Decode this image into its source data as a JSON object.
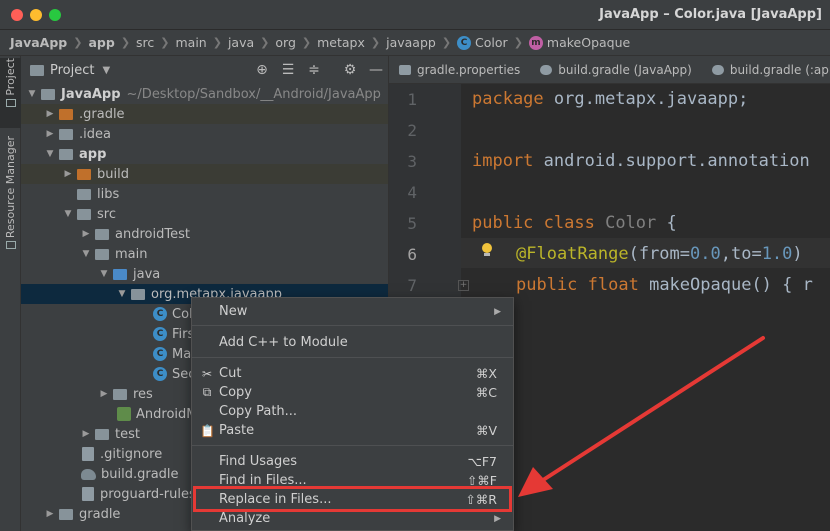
{
  "window": {
    "title": "JavaApp – Color.java [JavaApp]"
  },
  "breadcrumbs": [
    {
      "label": "JavaApp",
      "bold": true
    },
    {
      "label": "app",
      "bold": true
    },
    {
      "label": "src"
    },
    {
      "label": "main"
    },
    {
      "label": "java"
    },
    {
      "label": "org"
    },
    {
      "label": "metapx"
    },
    {
      "label": "javaapp"
    },
    {
      "label": "Color",
      "icon": "class-icon"
    },
    {
      "label": "makeOpaque",
      "icon": "method-icon"
    }
  ],
  "side_tabs": {
    "project": "Project",
    "resource_manager": "Resource Manager"
  },
  "project_panel": {
    "title": "Project"
  },
  "tree": [
    {
      "label": "JavaApp",
      "path": "~/Desktop/Sandbox/__Android/JavaApp"
    },
    {
      "label": ".gradle"
    },
    {
      "label": ".idea"
    },
    {
      "label": "app"
    },
    {
      "label": "build"
    },
    {
      "label": "libs"
    },
    {
      "label": "src"
    },
    {
      "label": "androidTest"
    },
    {
      "label": "main"
    },
    {
      "label": "java"
    },
    {
      "label": "org.metapx.javaapp"
    },
    {
      "label": "Col"
    },
    {
      "label": "Firs"
    },
    {
      "label": "Mai"
    },
    {
      "label": "Sec"
    },
    {
      "label": "res"
    },
    {
      "label": "AndroidM"
    },
    {
      "label": "test"
    },
    {
      "label": ".gitignore"
    },
    {
      "label": "build.gradle"
    },
    {
      "label": "proguard-rules"
    },
    {
      "label": "gradle"
    }
  ],
  "editor_tabs": [
    {
      "label": "gradle.properties"
    },
    {
      "label": "build.gradle (JavaApp)"
    },
    {
      "label": "build.gradle (:app)"
    }
  ],
  "code": {
    "line_numbers": [
      "1",
      "2",
      "3",
      "4",
      "5",
      "6",
      "7"
    ],
    "l1_kw": "package",
    "l1_rest": " org.metapx.javaapp;",
    "l3_kw": "import",
    "l3_rest": " android.support.annotation",
    "l5_kw1": "public",
    "l5_kw2": " class",
    "l5_name": " Color",
    "l5_brace": " {",
    "l6_ann": "@FloatRange",
    "l6_p1": "(from=",
    "l6_n1": "0.0",
    "l6_p2": ",to=",
    "l6_n2": "1.0",
    "l6_p3": ")",
    "l7_kw1": "public",
    "l7_kw2": " float",
    "l7_fn": " makeOpaque",
    "l7_rest": "() { r"
  },
  "context_menu": {
    "items": [
      {
        "label": "New",
        "submenu": true
      },
      {
        "label": "Add C++ to Module"
      },
      {
        "label": "Cut",
        "shortcut": "⌘X",
        "icon": "scissors-icon"
      },
      {
        "label": "Copy",
        "shortcut": "⌘C",
        "icon": "copy-icon"
      },
      {
        "label": "Copy Path..."
      },
      {
        "label": "Paste",
        "shortcut": "⌘V",
        "icon": "paste-icon"
      },
      {
        "label": "Find Usages",
        "shortcut": "⌥F7"
      },
      {
        "label": "Find in Files...",
        "shortcut": "⇧⌘F"
      },
      {
        "label": "Replace in Files...",
        "shortcut": "⇧⌘R",
        "highlighted": true
      },
      {
        "label": "Analyze",
        "submenu": true
      }
    ]
  },
  "colors": {
    "annotation_box": "#e53935",
    "arrow": "#e53935",
    "selection": "#0d293e",
    "keyword": "#cc7832",
    "annotation": "#bbb529",
    "number": "#6897bb"
  }
}
